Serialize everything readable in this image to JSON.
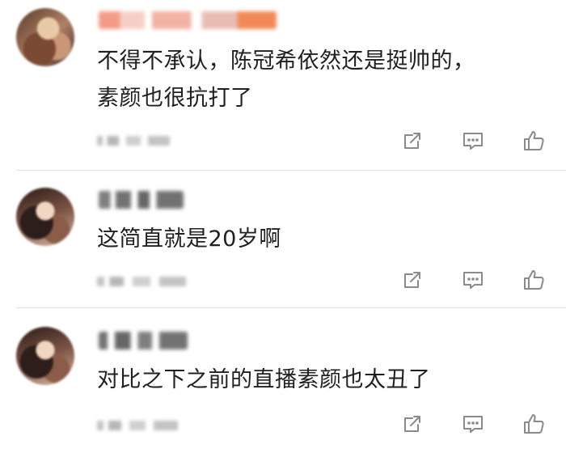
{
  "comments": [
    {
      "text_lines": [
        "不得不承认，陈冠希依然还是挺帅的，",
        "素颜也很抗打了"
      ]
    },
    {
      "text_lines": [
        "这简直就是20岁啊"
      ]
    },
    {
      "text_lines": [
        "对比之下之前的直播素颜也太丑了"
      ]
    }
  ],
  "icons": {
    "share": "share-icon",
    "comment": "comment-icon",
    "like": "like-icon"
  }
}
